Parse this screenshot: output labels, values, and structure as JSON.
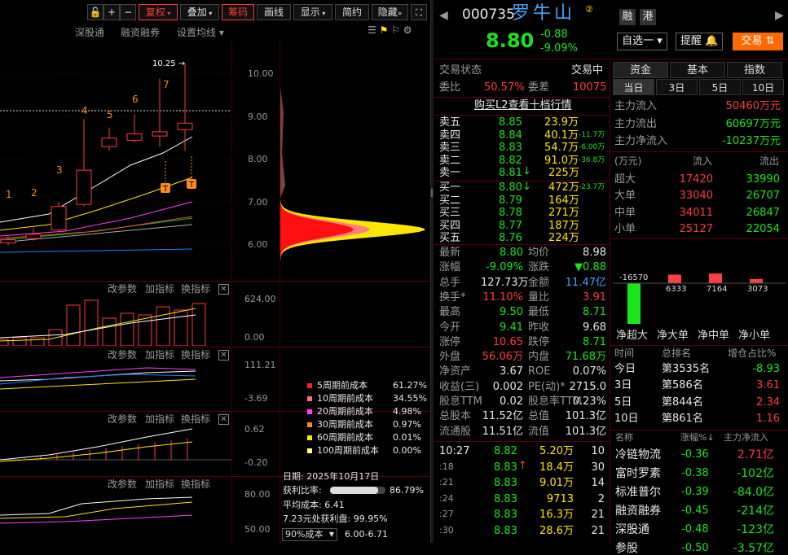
{
  "toolbar": {
    "lock_icon": "lock-icon",
    "plus": "+",
    "minus": "−",
    "fuquan": "复权",
    "diejia": "叠加",
    "chouma": "筹码",
    "huaxian": "画线",
    "xianshi": "显示",
    "jianyue": "简约",
    "yincang": "隐藏",
    "fullscreen": "fullscreen-icon"
  },
  "subbar": {
    "shengutong": "深股通",
    "rongzi": "融资融券",
    "setting": "设置均线"
  },
  "chart": {
    "price_max_label": "10.25",
    "y_ticks": [
      "10.00",
      "9.00",
      "8.00",
      "7.00",
      "6.00"
    ],
    "wave_labels": [
      "1",
      "2",
      "3",
      "4",
      "5",
      "6",
      "7"
    ],
    "t_marks": [
      "T",
      "T"
    ]
  },
  "candles": [
    {
      "o": 6.05,
      "c": 6.12,
      "h": 6.2,
      "l": 6.0,
      "up": true
    },
    {
      "o": 6.15,
      "c": 6.25,
      "h": 6.4,
      "l": 6.1,
      "up": true
    },
    {
      "o": 6.35,
      "c": 6.9,
      "h": 7.0,
      "l": 6.3,
      "up": true
    },
    {
      "o": 6.95,
      "c": 7.75,
      "h": 8.95,
      "l": 6.9,
      "up": true
    },
    {
      "o": 8.3,
      "c": 8.5,
      "h": 8.75,
      "l": 8.2,
      "up": true
    },
    {
      "o": 8.45,
      "c": 8.6,
      "h": 9.05,
      "l": 8.4,
      "up": true
    },
    {
      "o": 8.55,
      "c": 8.65,
      "h": 9.9,
      "l": 8.3,
      "up": true
    },
    {
      "o": 8.7,
      "c": 8.85,
      "h": 10.25,
      "l": 8.2,
      "up": true
    }
  ],
  "panels": {
    "gai_canshu": "改参数",
    "jia_zhibiao": "加指标",
    "huan_zhibiao": "换指标",
    "close": "close-icon",
    "vol_ticks": [
      "624.00",
      "0.00"
    ],
    "macd_ticks": [
      "111.21",
      "-3.69"
    ],
    "p3_ticks": [
      "0.62",
      "-0.20"
    ],
    "p4_ticks": [
      "80.00",
      "50.00"
    ]
  },
  "chip": {
    "legend": [
      {
        "label": "5周期前成本",
        "value": "61.27%",
        "color": "#ff2020"
      },
      {
        "label": "10周期前成本",
        "value": "34.55%",
        "color": "#ff7070"
      },
      {
        "label": "20周期前成本",
        "value": "4.98%",
        "color": "#ff40ff"
      },
      {
        "label": "30周期前成本",
        "value": "0.97%",
        "color": "#ff8c1a"
      },
      {
        "label": "60周期前成本",
        "value": "0.01%",
        "color": "#ffe600"
      },
      {
        "label": "100周期前成本",
        "value": "0.00%",
        "color": "#ffff80"
      }
    ],
    "date_label": "日期: 2025年10月17日",
    "profit_label": "获利比率:",
    "profit_ratio": "86.79%",
    "profit_fill": 0.8679,
    "avg_cost": "平均成本: 6.41",
    "profit_line": "7.23元处获利盘: 99.95%",
    "cost_select": "90%成本",
    "cost_range": "6.00-6.71"
  },
  "header": {
    "code": "000735",
    "name": "罗牛山",
    "badge": "②",
    "rong": "融",
    "gang": "港",
    "price": "8.80",
    "change": "-0.88",
    "pct": "-9.09%",
    "zixuan": "自选一",
    "tixing": "提醒",
    "jiaoyi": "交易"
  },
  "status": {
    "label": "交易状态",
    "value": "交易中",
    "weibi_label": "委比",
    "weibi": "50.57%",
    "weicha_label": "委差",
    "weicha": "10075",
    "l2": "购买L2查看十档行情"
  },
  "asks": [
    {
      "l": "卖五",
      "p": "8.85",
      "v": "23.9万",
      "x": ""
    },
    {
      "l": "卖四",
      "p": "8.84",
      "v": "40.1万",
      "x": "-11.7万"
    },
    {
      "l": "卖三",
      "p": "8.83",
      "v": "54.7万",
      "x": "-6.00万"
    },
    {
      "l": "卖二",
      "p": "8.82",
      "v": "91.0万",
      "x": "-36.8万"
    },
    {
      "l": "卖一",
      "p": "8.81",
      "v": "225万",
      "x": ""
    }
  ],
  "bids": [
    {
      "l": "买一",
      "p": "8.80",
      "v": "472万",
      "x": "-23.7万"
    },
    {
      "l": "买二",
      "p": "8.79",
      "v": "164万",
      "x": ""
    },
    {
      "l": "买三",
      "p": "8.78",
      "v": "271万",
      "x": ""
    },
    {
      "l": "买四",
      "p": "8.77",
      "v": "187万",
      "x": ""
    },
    {
      "l": "买五",
      "p": "8.76",
      "v": "224万",
      "x": ""
    }
  ],
  "stats": [
    [
      "最新",
      "8.80",
      "均价",
      "8.98"
    ],
    [
      "涨幅",
      "-9.09%",
      "涨跌",
      "▼0.88"
    ],
    [
      "总手",
      "127.73万",
      "金额",
      "11.47亿"
    ],
    [
      "换手*",
      "11.10%",
      "量比",
      "3.91"
    ],
    [
      "最高",
      "9.50",
      "最低",
      "8.71"
    ],
    [
      "今开",
      "9.41",
      "昨收",
      "9.68"
    ],
    [
      "涨停",
      "10.65",
      "跌停",
      "8.71"
    ],
    [
      "外盘",
      "56.06万",
      "内盘",
      "71.68万"
    ],
    [
      "净资产",
      "3.67",
      "ROE",
      "0.07%"
    ],
    [
      "收益(三)",
      "0.002",
      "PE(动)*",
      "2715.0"
    ],
    [
      "股息TTM",
      "0.02",
      "股息率TTM",
      "0.23%"
    ],
    [
      "总股本",
      "11.52亿",
      "总值",
      "101.3亿"
    ],
    [
      "流通股",
      "11.51亿",
      "流值",
      "101.3亿"
    ]
  ],
  "ticks": [
    {
      "t": "10:27",
      "p": "8.82",
      "v": "5.20万",
      "n": "10"
    },
    {
      "t": ":18",
      "p": "8.83",
      "v": "18.4万",
      "n": "30"
    },
    {
      "t": ":21",
      "p": "8.83",
      "v": "9.01万",
      "n": "14"
    },
    {
      "t": ":24",
      "p": "8.83",
      "v": "9713",
      "n": "2"
    },
    {
      "t": ":27",
      "p": "8.83",
      "v": "16.3万",
      "n": "21"
    },
    {
      "t": ":30",
      "p": "8.83",
      "v": "28.6万",
      "n": "21"
    }
  ],
  "fund": {
    "tabs": [
      "资金",
      "基本",
      "指数"
    ],
    "days": [
      "当日",
      "3日",
      "5日",
      "10日"
    ],
    "inflow_label": "主力流入",
    "inflow": "50460万元",
    "outflow_label": "主力流出",
    "outflow": "60697万元",
    "net_label": "主力净流入",
    "net": "-10237万元",
    "unit": "(万元)",
    "in": "流入",
    "out": "流出",
    "rows": [
      [
        "超大",
        "17420",
        "33990"
      ],
      [
        "大单",
        "33040",
        "26707"
      ],
      [
        "中单",
        "34011",
        "26847"
      ],
      [
        "小单",
        "25127",
        "22054"
      ]
    ],
    "bars": [
      {
        "label": "净超大",
        "value": -16570
      },
      {
        "label": "净大单",
        "value": 6333
      },
      {
        "label": "净中单",
        "value": 7164
      },
      {
        "label": "净小单",
        "value": 3073
      }
    ]
  },
  "rank": {
    "h_time": "时间",
    "h_total": "总排名",
    "h_ratio": "增仓占比%",
    "rows": [
      [
        "今日",
        "第3535名",
        "-8.93"
      ],
      [
        "3日",
        "第586名",
        "3.61"
      ],
      [
        "5日",
        "第844名",
        "2.34"
      ],
      [
        "10日",
        "第861名",
        "1.16"
      ]
    ]
  },
  "board": {
    "h_name": "名称",
    "h_change": "涨幅%↓",
    "h_net": "主力净流入",
    "rows": [
      [
        "冷链物流",
        "-0.36",
        "2.71亿"
      ],
      [
        "富时罗素",
        "-0.38",
        "-102亿"
      ],
      [
        "标准普尔",
        "-0.39",
        "-84.0亿"
      ],
      [
        "融资融券",
        "-0.45",
        "-214亿"
      ],
      [
        "深股通",
        "-0.48",
        "-123亿"
      ],
      [
        "参股",
        "-0.50",
        "-3.57亿"
      ]
    ]
  }
}
